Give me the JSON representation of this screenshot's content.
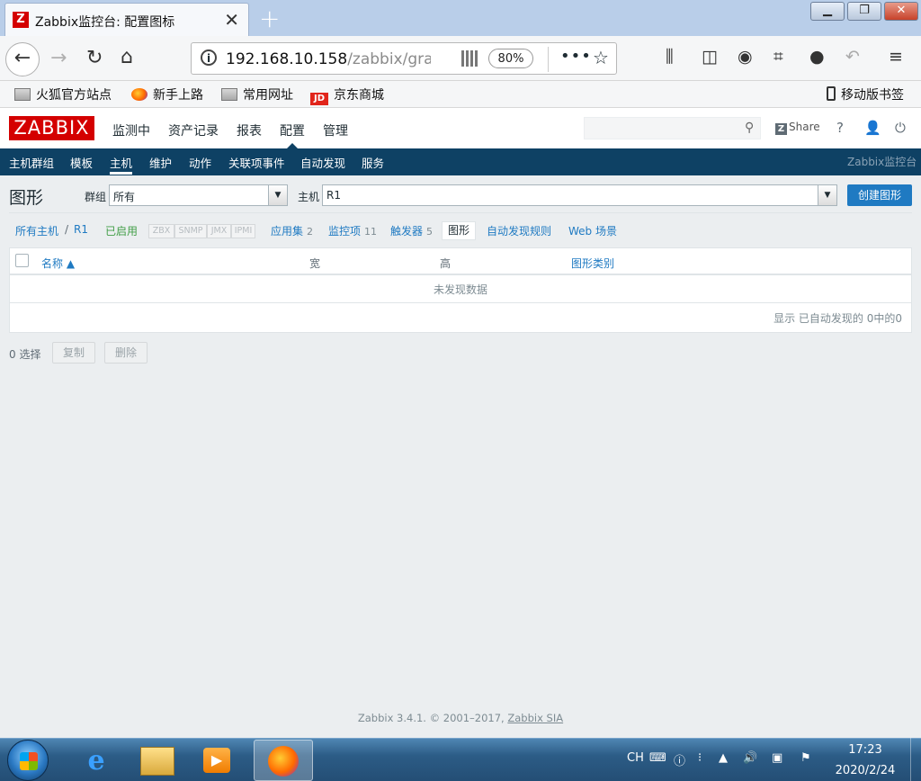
{
  "browser": {
    "tab_title": "Zabbix监控台: 配置图标",
    "tab_logo": "Z",
    "url_host": "192.168.10.158",
    "url_path": "/zabbix/grap",
    "zoom": "80%",
    "bookmarks": [
      "火狐官方站点",
      "新手上路",
      "常用网址",
      "京东商城"
    ],
    "mobile_bookmarks": "移动版书签",
    "jd_badge": "JD"
  },
  "zabbix": {
    "logo": "ZABBIX",
    "top_menu": [
      "监测中",
      "资产记录",
      "报表",
      "配置",
      "管理"
    ],
    "active_top": "配置",
    "share": "Share",
    "share_badge": "Z",
    "help": "?",
    "sub_menu": [
      "主机群组",
      "模板",
      "主机",
      "维护",
      "动作",
      "关联项事件",
      "自动发现",
      "服务"
    ],
    "active_sub": "主机",
    "site_name": "Zabbix监控台"
  },
  "page": {
    "title": "图形",
    "group_label": "群组",
    "group_value": "所有",
    "host_label": "主机",
    "host_value": "R1",
    "create_button": "创建图形"
  },
  "host_nav": {
    "all_hosts": "所有主机",
    "separator": "/",
    "host": "R1",
    "status": "已启用",
    "availability": [
      "ZBX",
      "SNMP",
      "JMX",
      "IPMI"
    ],
    "applications": {
      "label": "应用集",
      "count": "2"
    },
    "items": {
      "label": "监控项",
      "count": "11"
    },
    "triggers": {
      "label": "触发器",
      "count": "5"
    },
    "graphs": "图形",
    "discovery": "自动发现规则",
    "web": "Web 场景"
  },
  "table": {
    "columns": [
      "名称 ▲",
      "宽",
      "高",
      "图形类别"
    ],
    "empty_text": "未发现数据",
    "footer": "显示 已自动发现的 0中的0"
  },
  "actions": {
    "selected": "0 选择",
    "copy": "复制",
    "delete": "删除"
  },
  "footer": {
    "text": "Zabbix 3.4.1. © 2001–2017, ",
    "link": "Zabbix SIA"
  },
  "taskbar": {
    "ime": "CH",
    "time": "17:23",
    "date": "2020/2/24"
  }
}
